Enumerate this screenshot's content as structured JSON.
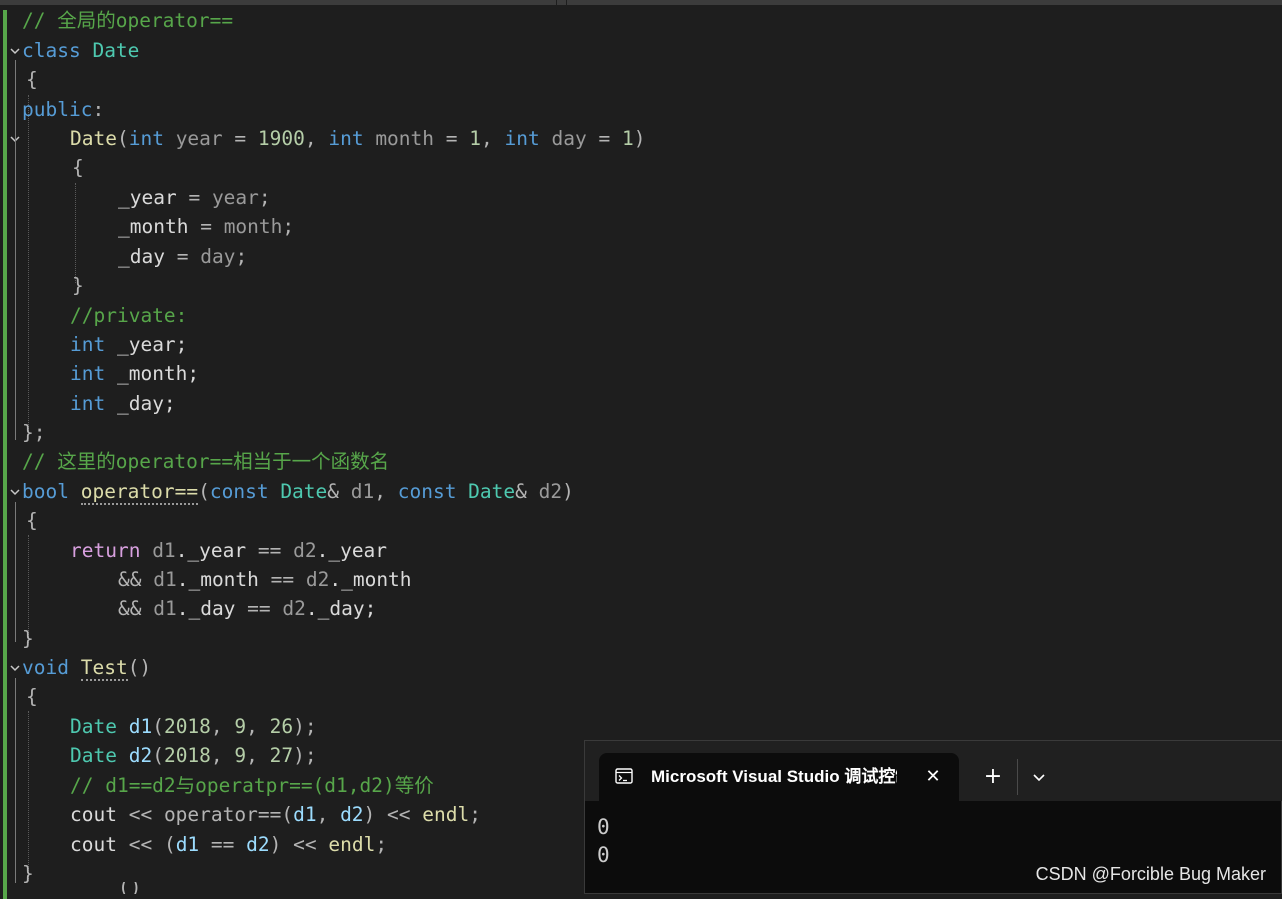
{
  "editor": {
    "lines": {
      "l1_comment": "// 全局的operator==",
      "l2_class": "class",
      "l2_name": "Date",
      "l3_brace": "{",
      "l4_public": "public",
      "l4_colon": ":",
      "l5_ctor": "Date",
      "l5_p1": "(",
      "l5_int1": "int",
      "l5_year": " year",
      "l5_eq1": " = ",
      "l5_1900": "1900",
      "l5_c1": ", ",
      "l5_int2": "int",
      "l5_month": " month",
      "l5_eq2": " = ",
      "l5_1a": "1",
      "l5_c2": ", ",
      "l5_int3": "int",
      "l5_day": " day",
      "l5_eq3": " = ",
      "l5_1b": "1",
      "l5_p2": ")",
      "l6_brace": "{",
      "l7_member": "_year",
      "l7_eq": " = ",
      "l7_param": "year",
      "l7_semi": ";",
      "l8_member": "_month",
      "l8_eq": " = ",
      "l8_param": "month",
      "l8_semi": ";",
      "l9_member": "_day",
      "l9_eq": " = ",
      "l9_param": "day",
      "l9_semi": ";",
      "l10_brace": "}",
      "l11_comment": "//private:",
      "l12_int": "int",
      "l12_rest": " _year;",
      "l13_int": "int",
      "l13_rest": " _month;",
      "l14_int": "int",
      "l14_rest": " _day;",
      "l15_end": "};",
      "l16_comment": "// 这里的operator==相当于一个函数名",
      "l17_bool": "bool",
      "l17_fn": "operator==",
      "l17_p1": "(",
      "l17_const1": "const",
      "l17_type1": " Date",
      "l17_ref1": "& ",
      "l17_d1": "d1",
      "l17_comma": ", ",
      "l17_const2": "const",
      "l17_type2": " Date",
      "l17_ref2": "& ",
      "l17_d2": "d2",
      "l17_p2": ")",
      "l18_brace": "{",
      "l19_return": "return",
      "l19_d1": " d1",
      "l19_m1": "._year",
      "l19_eq": " == ",
      "l19_d2": "d2",
      "l19_m2": "._year",
      "l20_and": "&&",
      "l20_d1": " d1",
      "l20_m1": "._month",
      "l20_eq": " == ",
      "l20_d2": "d2",
      "l20_m2": "._month",
      "l21_and": "&&",
      "l21_d1": " d1",
      "l21_m1": "._day",
      "l21_eq": " == ",
      "l21_d2": "d2",
      "l21_m2": "._day;",
      "l22_brace": "}",
      "l23_void": "void",
      "l23_fn": "Test",
      "l23_parens": "()",
      "l24_brace": "{",
      "l25_type": "Date",
      "l25_var": " d1",
      "l25_p1": "(",
      "l25_n1": "2018",
      "l25_c1": ", ",
      "l25_n2": "9",
      "l25_c2": ", ",
      "l25_n3": "26",
      "l25_end": ");",
      "l26_type": "Date",
      "l26_var": " d2",
      "l26_p1": "(",
      "l26_n1": "2018",
      "l26_c1": ", ",
      "l26_n2": "9",
      "l26_c2": ", ",
      "l26_n3": "27",
      "l26_end": ");",
      "l27_comment": "// d1==d2与operatpr==(d1,d2)等价",
      "l28_cout": "cout",
      "l28_shl1": " << ",
      "l28_fn": "operator==",
      "l28_p1": "(",
      "l28_d1": "d1",
      "l28_comma": ", ",
      "l28_d2": "d2",
      "l28_p2": ")",
      "l28_shl2": " << ",
      "l28_endl": "endl",
      "l28_semi": ";",
      "l29_cout": "cout",
      "l29_shl1": " << ",
      "l29_p1": "(",
      "l29_d1": "d1",
      "l29_eq": " == ",
      "l29_d2": "d2",
      "l29_p2": ")",
      "l29_shl2": " << ",
      "l29_endl": "endl",
      "l29_semi": ";",
      "l30_brace": "}",
      "l31_partial": "()"
    }
  },
  "console": {
    "tab_title": "Microsoft Visual Studio 调试控制台",
    "close_label": "✕",
    "new_tab_label": "+",
    "output": [
      "0",
      "0"
    ]
  },
  "watermark": "CSDN @Forcible Bug Maker",
  "icons": {
    "tab_icon": "console-window-icon",
    "dropdown": "chevron-down-icon",
    "fold_marker": "chevron-down-icon"
  },
  "colors": {
    "background": "#1e1e1e",
    "keyword": "#569cd6",
    "comment": "#57a64a",
    "type": "#4ec9b0",
    "function": "#dcdcaa",
    "number": "#b5cea8",
    "parameter": "#9a9a9a",
    "variable": "#9cdcfe",
    "control": "#d8a0df",
    "change_bar": "#57a64a"
  }
}
